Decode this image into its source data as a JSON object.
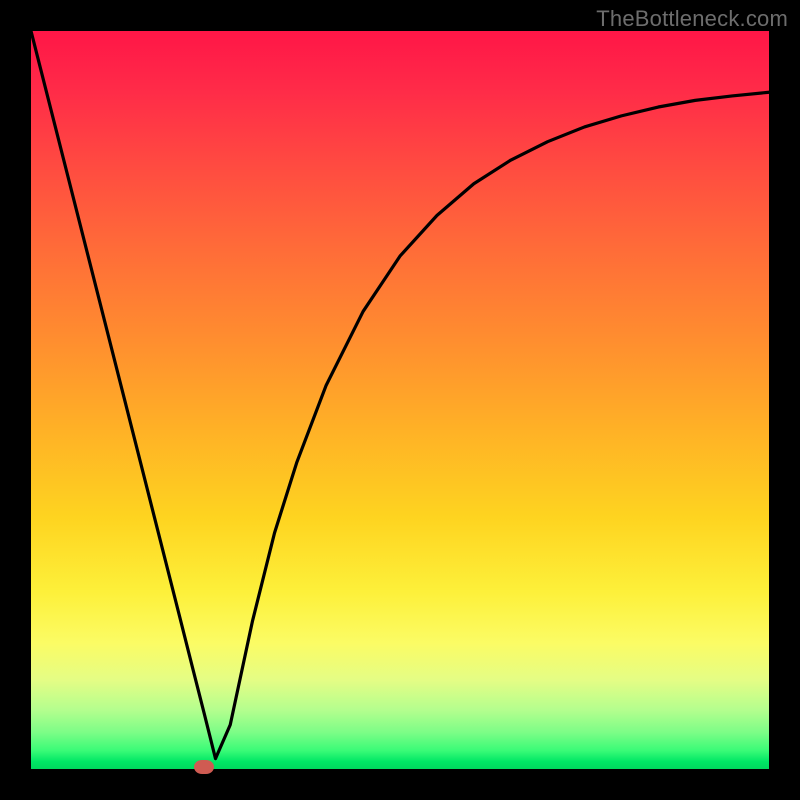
{
  "attribution": "TheBottleneck.com",
  "colors": {
    "frame": "#000000",
    "curve": "#000000",
    "marker": "#cf5b52",
    "attribution": "#6d6d6d"
  },
  "chart_data": {
    "type": "line",
    "title": "",
    "xlabel": "",
    "ylabel": "",
    "xlim": [
      0,
      100
    ],
    "ylim": [
      0,
      100
    ],
    "grid": false,
    "series": [
      {
        "name": "bottleneck-curve",
        "x": [
          0,
          5,
          10,
          15,
          20,
          22,
          23.5,
          25,
          27,
          30,
          33,
          36,
          40,
          45,
          50,
          55,
          60,
          65,
          70,
          75,
          80,
          85,
          90,
          95,
          100
        ],
        "values": [
          100,
          80.3,
          60.6,
          40.9,
          21.2,
          13.3,
          7.4,
          1.4,
          6.0,
          20.0,
          32.0,
          41.5,
          52.0,
          62.0,
          69.5,
          75.0,
          79.3,
          82.5,
          85.0,
          87.0,
          88.5,
          89.7,
          90.6,
          91.2,
          91.7
        ]
      }
    ],
    "annotations": [
      {
        "name": "minimum-marker",
        "x": 23.5,
        "y": 0
      }
    ]
  }
}
